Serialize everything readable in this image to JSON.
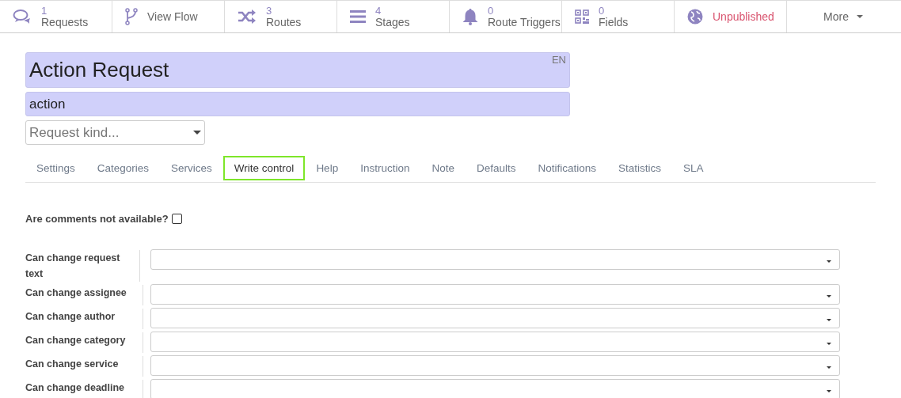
{
  "nav": [
    {
      "kind": "stat",
      "count": "1",
      "label": "Requests"
    },
    {
      "kind": "link",
      "label": "View Flow"
    },
    {
      "kind": "stat",
      "count": "3",
      "label": "Routes"
    },
    {
      "kind": "stat",
      "count": "4",
      "label": "Stages"
    },
    {
      "kind": "stat",
      "count": "0",
      "label": "Route Triggers"
    },
    {
      "kind": "stat",
      "count": "0",
      "label": "Fields"
    },
    {
      "kind": "status",
      "label": "Unpublished"
    },
    {
      "kind": "menu",
      "label": "More"
    }
  ],
  "title": {
    "value": "Action Request",
    "lang": "EN"
  },
  "code": {
    "value": "action"
  },
  "request_kind": {
    "placeholder": "Request kind..."
  },
  "tabs": [
    {
      "label": "Settings",
      "selected": false
    },
    {
      "label": "Categories",
      "selected": false
    },
    {
      "label": "Services",
      "selected": false
    },
    {
      "label": "Write control",
      "selected": true
    },
    {
      "label": "Help",
      "selected": false
    },
    {
      "label": "Instruction",
      "selected": false
    },
    {
      "label": "Note",
      "selected": false
    },
    {
      "label": "Defaults",
      "selected": false
    },
    {
      "label": "Notifications",
      "selected": false
    },
    {
      "label": "Statistics",
      "selected": false
    },
    {
      "label": "SLA",
      "selected": false
    }
  ],
  "comments_toggle": {
    "label": "Are comments not available?",
    "checked": false
  },
  "permissions": [
    {
      "label": "Can change request text"
    },
    {
      "label": "Can change assignee"
    },
    {
      "label": "Can change author"
    },
    {
      "label": "Can change category"
    },
    {
      "label": "Can change service"
    },
    {
      "label": "Can change deadline"
    }
  ]
}
